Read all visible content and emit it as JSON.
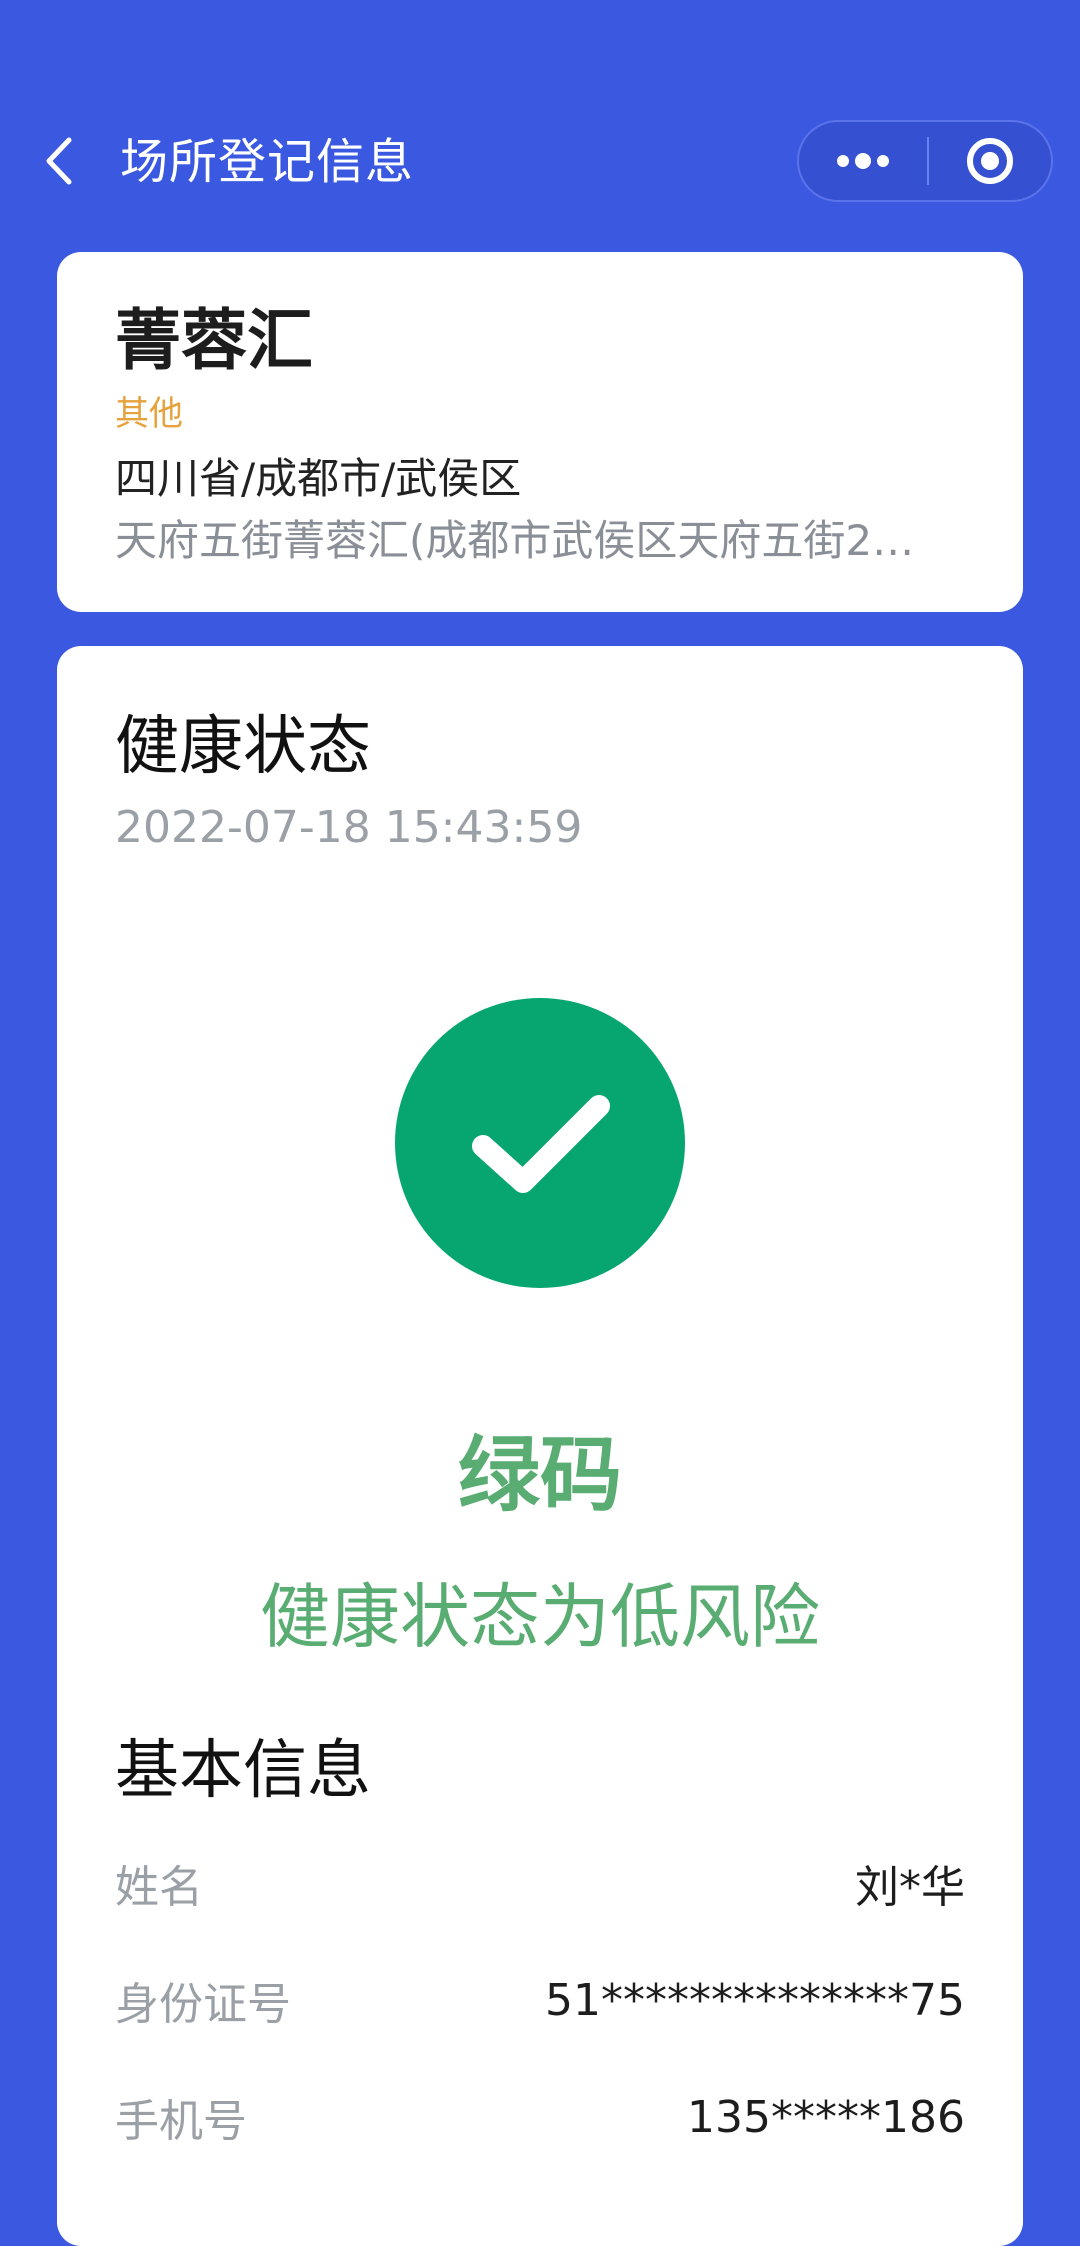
{
  "nav": {
    "title": "场所登记信息",
    "back_icon": "chevron-left-icon",
    "more_icon": "more-dots-icon",
    "close_icon": "target-circle-icon"
  },
  "place": {
    "name": "菁蓉汇",
    "category": "其他",
    "region": "四川省/成都市/武侯区",
    "address": "天府五街菁蓉汇(成都市武侯区天府五街2…"
  },
  "health": {
    "title": "健康状态",
    "timestamp": "2022-07-18 15:43:59",
    "status_icon": "checkmark-icon",
    "code": "绿码",
    "risk": "健康状态为低风险",
    "status_color": "#07a56f"
  },
  "basic_info": {
    "title": "基本信息",
    "rows": [
      {
        "label": "姓名",
        "value": "刘*华"
      },
      {
        "label": "身份证号",
        "value": "51**************75"
      },
      {
        "label": "手机号",
        "value": "135*****186"
      }
    ]
  },
  "colors": {
    "background": "#3b58e0",
    "category": "#e6a23c",
    "green_text": "#5aad72"
  }
}
